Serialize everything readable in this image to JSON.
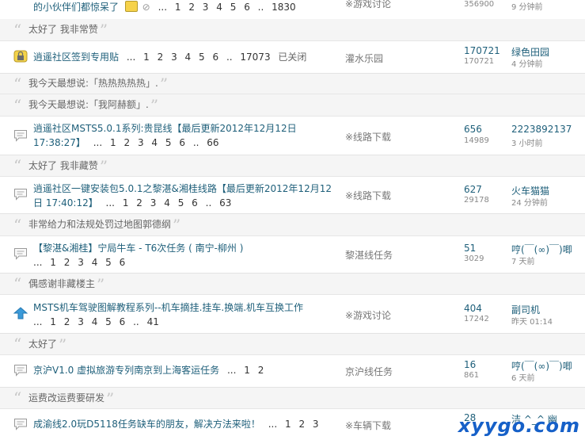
{
  "threads": [
    {
      "title_part": "的小伙伴们都惊呆了",
      "pages": [
        "1",
        "2",
        "3",
        "4",
        "5",
        "6"
      ],
      "last_page": "1830",
      "forum": "※游戏讨论",
      "views": "356900",
      "time": "9 分钟前"
    },
    {
      "title": "逍遥社区签到专用贴",
      "pages": [
        "1",
        "2",
        "3",
        "4",
        "5",
        "6"
      ],
      "last_page": "17073",
      "status": "已关闭",
      "forum": "灌水乐园",
      "replies": "170721",
      "views": "170721",
      "author": "绿色田园",
      "time": "4 分钟前"
    },
    {
      "title": "逍遥社区MSTS5.0.1系列:贵昆线【最后更新2012年12月12日 17:38:27】",
      "pages": [
        "1",
        "2",
        "3",
        "4",
        "5",
        "6"
      ],
      "last_page": "66",
      "forum": "※线路下载",
      "replies": "656",
      "views": "14989",
      "author": "2223892137",
      "time": "3 小时前"
    },
    {
      "title": "逍遥社区一键安装包5.0.1之黎湛&湘桂线路【最后更新2012年12月12日 17:40:12】",
      "pages": [
        "1",
        "2",
        "3",
        "4",
        "5",
        "6"
      ],
      "last_page": "63",
      "forum": "※线路下载",
      "replies": "627",
      "views": "29178",
      "author": "火车猫猫",
      "time": "24 分钟前"
    },
    {
      "title": "【黎湛&湘桂】宁局牛车 - T6次任务 ( 南宁-柳州 )",
      "pages": [
        "1",
        "2",
        "3",
        "4",
        "5",
        "6"
      ],
      "forum": "黎湛线任务",
      "replies": "51",
      "views": "3029",
      "author": "哼(￣(∞)￣)唧",
      "time": "7 天前"
    },
    {
      "title": "MSTS机车驾驶图解教程系列--机车摘挂.挂车.换端.机车互换工作",
      "pages": [
        "1",
        "2",
        "3",
        "4",
        "5",
        "6"
      ],
      "last_page": "41",
      "forum": "※游戏讨论",
      "replies": "404",
      "views": "17242",
      "author": "副司机",
      "time": "昨天 01:14"
    },
    {
      "title": "京沪V1.0 虚拟旅游专列南京到上海客运任务",
      "pages": [
        "1",
        "2"
      ],
      "forum": "京沪线任务",
      "replies": "16",
      "views": "861",
      "author": "哼(￣(∞)￣)唧",
      "time": "6 天前"
    },
    {
      "title": "成渝线2.0玩D5118任务缺车的朋友，解决方法来啦！",
      "pages": [
        "1",
        "2",
        "3"
      ],
      "forum": "※车辆下载",
      "replies": "28",
      "author": "洁 ^_^ 幽"
    }
  ],
  "quotes": [
    "太好了 我非常赞",
    "我今天最想说:「热热热热热」.",
    "我今天最想说:「我阿赫额」.",
    "太好了 我非藏赞",
    "非常给力和法规处罚过地图郭德纲",
    "偶感谢非藏楼主",
    "太好了",
    "运费改运费要研发"
  ],
  "ellipsis": "...",
  "dots": "..",
  "watermark": "xyygo.com",
  "colors": {
    "link": "#1e5f7a",
    "quote_bg": "#f5f5f5",
    "watermark": "#1660c8"
  }
}
